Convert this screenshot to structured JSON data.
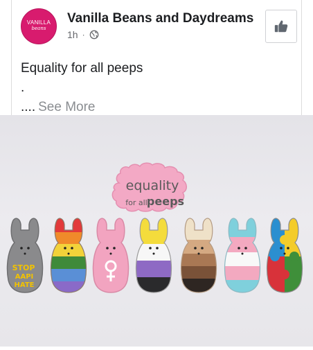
{
  "post": {
    "page_name": "Vanilla Beans and Daydreams",
    "time": "1h",
    "separator": "·",
    "privacy_icon": "globe-icon",
    "like_icon": "thumbs-up-icon",
    "avatar": {
      "line1": "VANILLA",
      "line2": "beans"
    },
    "text_line1": "Equality for all peeps",
    "text_line2": ".",
    "text_line3": "....",
    "see_more": "See More"
  },
  "photo": {
    "plaque_line1": "equality",
    "plaque_line2_small": "for all",
    "plaque_line2_big": "peeps",
    "peep1_text1": "STOP",
    "peep1_text2": "AAPI",
    "peep1_text3": "HATE",
    "colors": {
      "background": "#e8e7eb",
      "plaque": "#f3a9c5",
      "plaque_text": "#5a5a5a"
    }
  }
}
